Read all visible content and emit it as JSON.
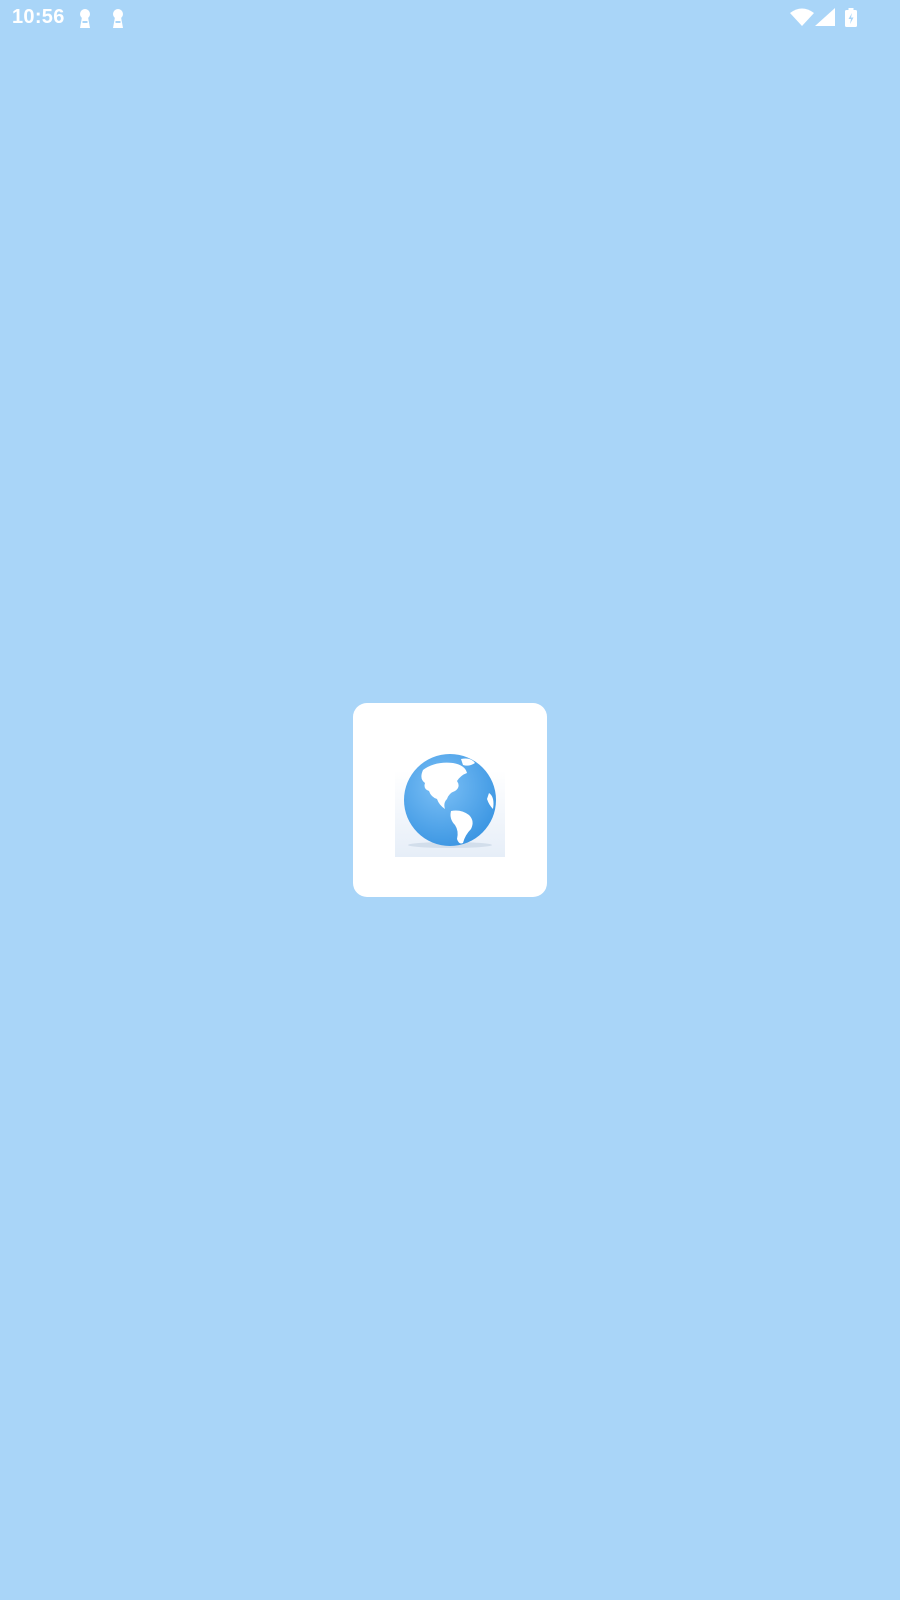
{
  "status_bar": {
    "time": "10:56",
    "notification_icons": [
      "keyhole-icon",
      "keyhole-icon"
    ],
    "system_icons": [
      "wifi-icon",
      "cellular-signal-icon",
      "battery-charging-icon"
    ]
  },
  "splash": {
    "logo_icon": "globe-icon"
  },
  "colors": {
    "background": "#a9d5f8",
    "card": "#ffffff",
    "globe": "#52a8ee",
    "status_text": "#ffffff"
  }
}
